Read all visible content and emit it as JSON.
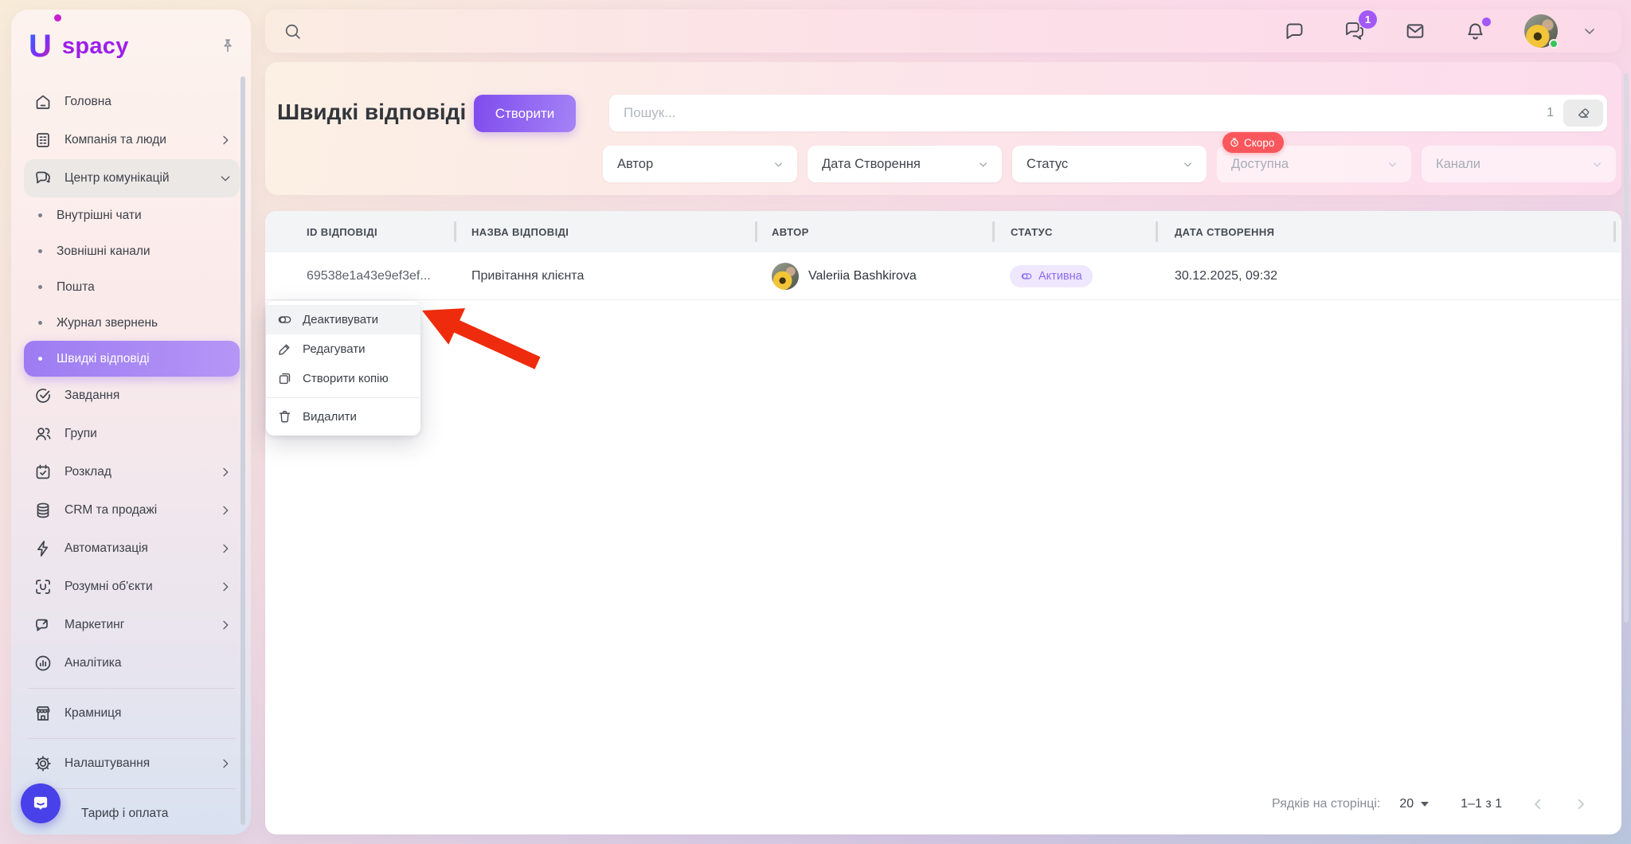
{
  "app": {
    "logo_letter": "U",
    "logo_text": "spacy"
  },
  "topbar": {
    "chat_badge": "1"
  },
  "colors": {
    "accent_purple": "#8b5cf6",
    "active_item_gradient": [
      "#9d7cf2",
      "#b596f6"
    ],
    "soon_badge_red": "#f9575c",
    "status_active_bg": "#eee7fd",
    "status_active_text": "#8e6cf0",
    "arrow_red": "#ee2b0c",
    "intercom_indigo": "#4840e8",
    "notification_purple": "#a259f7",
    "online_green": "#35c75a"
  },
  "sidebar": {
    "items": [
      {
        "label": "Головна",
        "icon": "home"
      },
      {
        "label": "Компанія та люди",
        "icon": "company",
        "chevron": "right"
      },
      {
        "label": "Центр комунікацій",
        "icon": "communication",
        "chevron": "down",
        "expanded": true
      },
      {
        "label": "Внутрішні чати",
        "sub": true
      },
      {
        "label": "Зовнішні канали",
        "sub": true
      },
      {
        "label": "Пошта",
        "sub": true
      },
      {
        "label": "Журнал звернень",
        "sub": true
      },
      {
        "label": "Швидкі відповіді",
        "sub": true,
        "active": true
      },
      {
        "label": "Завдання",
        "icon": "tasks"
      },
      {
        "label": "Групи",
        "icon": "groups"
      },
      {
        "label": "Розклад",
        "icon": "calendar",
        "chevron": "right"
      },
      {
        "label": "CRM та продажі",
        "icon": "crm",
        "chevron": "right"
      },
      {
        "label": "Автоматизація",
        "icon": "automation",
        "chevron": "right"
      },
      {
        "label": "Розумні об'єкти",
        "icon": "smart-objects",
        "chevron": "right"
      },
      {
        "label": "Маркетинг",
        "icon": "marketing",
        "chevron": "right"
      },
      {
        "label": "Аналітика",
        "icon": "analytics"
      },
      {
        "label": "Крамниця",
        "icon": "store"
      },
      {
        "label": "Налаштування",
        "icon": "settings",
        "chevron": "right"
      },
      {
        "label": "Тариф і оплата",
        "icon": "billing"
      }
    ]
  },
  "page": {
    "title": "Швидкі відповіді",
    "create_button": "Створити",
    "search_placeholder": "Пошук...",
    "search_count": "1",
    "soon_badge": "Скоро",
    "filters": [
      {
        "label": "Автор",
        "enabled": true
      },
      {
        "label": "Дата Створення",
        "enabled": true
      },
      {
        "label": "Статус",
        "enabled": true
      },
      {
        "label": "Доступна",
        "enabled": false
      },
      {
        "label": "Канали",
        "enabled": false
      }
    ]
  },
  "table": {
    "columns": [
      "ID ВІДПОВІДІ",
      "НАЗВА ВІДПОВІДІ",
      "АВТОР",
      "СТАТУС",
      "ДАТА СТВОРЕННЯ"
    ],
    "rows": [
      {
        "id": "69538e1a43e9ef3ef...",
        "name": "Привітання клієнта",
        "author": "Valeriia Bashkirova",
        "status": "Активна",
        "created": "30.12.2025, 09:32"
      }
    ]
  },
  "context_menu": {
    "items": [
      {
        "label": "Деактивувати",
        "icon": "toggle"
      },
      {
        "label": "Редагувати",
        "icon": "pencil"
      },
      {
        "label": "Створити копію",
        "icon": "copy"
      },
      {
        "label": "Видалити",
        "icon": "trash"
      }
    ]
  },
  "pagination": {
    "label": "Рядків на сторінці:",
    "per_page": "20",
    "range": "1–1 з 1"
  }
}
